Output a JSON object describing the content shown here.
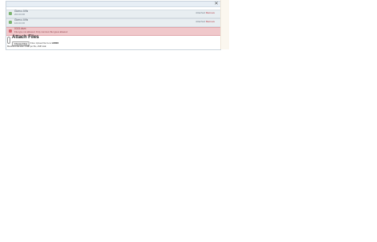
{
  "dialog": {
    "close_glyph": "✕"
  },
  "files": [
    {
      "name": "Glam.c.li.fils",
      "sub": "200.00 KB",
      "status": "Attached",
      "action": "Remove",
      "state": "ok"
    },
    {
      "name": "Glam.c.li.fils",
      "sub": "100.00 KB",
      "status": "Attached",
      "action": "Remove",
      "state": "ok"
    },
    {
      "name": "0015.xlsm",
      "sub": "File type not allowed. Only common file types allowed.",
      "status": "",
      "action": "",
      "state": "error"
    }
  ],
  "attach": {
    "title": "Attach Files",
    "choose_button": "Choose Files",
    "chosen_prefix": "Files",
    "chosen_text": "Upload file here",
    "chosen_count": "1/3000",
    "max_prefix": "Maximum file size:",
    "max_value": "5 MB per file, 2GB total"
  },
  "colors": {
    "ok": "#7bb36f",
    "error_bg": "#f0c8cb",
    "error": "#d36b73",
    "delete": "#b0303b"
  }
}
